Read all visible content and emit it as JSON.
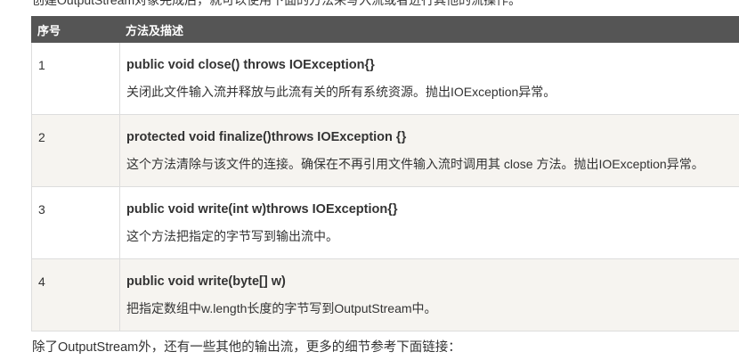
{
  "intro_text": "创建OutputStream对象完成后，就可以使用下面的方法来写入流或者进行其他的流操作。",
  "table": {
    "headers": [
      "序号",
      "方法及描述"
    ],
    "rows": [
      {
        "num": "1",
        "signature": "public void close() throws IOException{}",
        "description": "关闭此文件输入流并释放与此流有关的所有系统资源。抛出IOException异常。"
      },
      {
        "num": "2",
        "signature": "protected void finalize()throws IOException {}",
        "description": "这个方法清除与该文件的连接。确保在不再引用文件输入流时调用其 close 方法。抛出IOException异常。"
      },
      {
        "num": "3",
        "signature": "public void write(int w)throws IOException{}",
        "description": "这个方法把指定的字节写到输出流中。"
      },
      {
        "num": "4",
        "signature": "public void write(byte[] w)",
        "description": "把指定数组中w.length长度的字节写到OutputStream中。"
      }
    ]
  },
  "footer_text": "除了OutputStream外，还有一些其他的输出流，更多的细节参考下面链接："
}
